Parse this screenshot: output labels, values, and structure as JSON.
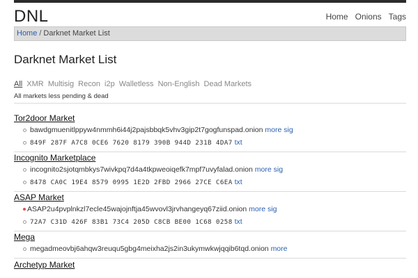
{
  "nav": {
    "brand": "DNL",
    "links": [
      "Home",
      "Onions",
      "Tags"
    ]
  },
  "breadcrumb": {
    "home": "Home",
    "separator": "/",
    "current": "Darknet Market List"
  },
  "page": {
    "title": "Darknet Market List",
    "filters": [
      "All",
      "XMR",
      "Multisig",
      "Recon",
      "i2p",
      "Walletless",
      "Non-English",
      "Dead Markets"
    ],
    "active_filter": "All",
    "subnote": "All markets less pending & dead"
  },
  "markets": [
    {
      "name": "Tor2door Market",
      "onion": "bawdgmuenitlppyw4nmmh6i44j2pajsbbqk5vhv3gip2t7gogfunspad.onion",
      "onion_link": "more sig",
      "fingerprint": "849F 287F A7C8 0CE6 7620 8179 390B 944D 231B 4DA7",
      "fp_link": "txt",
      "status": "ok"
    },
    {
      "name": "Incognito Marketplace",
      "onion": "incognito2sjotqmbkys7wivkpq7d4a4tkpweoiqefk7mpf7uvyfalad.onion",
      "onion_link": "more sig",
      "fingerprint": "8478 CA0C 19E4 8579 0995 1E2D 2FBD 2966 27CE C6EA",
      "fp_link": "txt",
      "status": "ok"
    },
    {
      "name": "ASAP Market",
      "onion": "ASAP2u4pvplnkzl7ecle45wajojnftja45wvovl3jrvhangeyq67ziid.onion",
      "onion_link": "more sig",
      "fingerprint": "72A7 C31D 426F 83B1 73C4 205D C8CB BE00 1C68 0258",
      "fp_link": "txt",
      "status": "red"
    },
    {
      "name": "Mega",
      "onion": "megadmeovbj6ahqw3reuqu5gbg4meixha2js2in3ukymwkwjqqib6tqd.onion",
      "onion_link": "more",
      "status": "ok"
    },
    {
      "name": "Archetyp Market",
      "status": "ok"
    }
  ]
}
